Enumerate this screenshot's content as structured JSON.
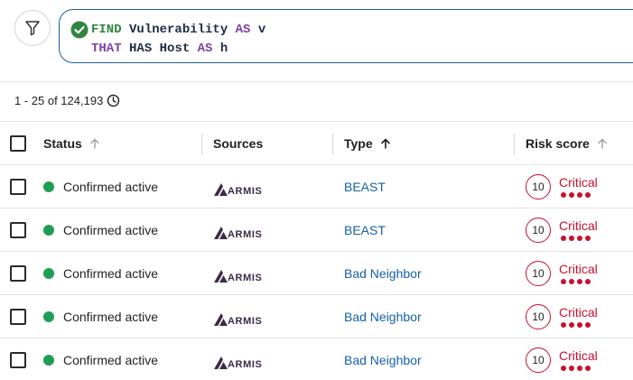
{
  "query": {
    "line1": {
      "kw1": "FIND",
      "ident1": "Vulnerability",
      "kw2": "AS",
      "ident2": "v"
    },
    "line2": {
      "kw1": "THAT",
      "kw2": "HAS",
      "ident1": "Host",
      "kw3": "AS",
      "ident2": "h"
    },
    "valid_icon": "check-circle-icon"
  },
  "filter_button_icon": "funnel-icon",
  "results": {
    "range_label": "1 - 25 of 124,193",
    "icon": "clock-icon"
  },
  "table": {
    "headers": {
      "status": "Status",
      "sources": "Sources",
      "type": "Type",
      "risk": "Risk score"
    },
    "sort": {
      "status": "inactive-up",
      "type": "active-up",
      "risk": "inactive-up"
    },
    "rows": [
      {
        "status": "Confirmed active",
        "source": "ARMIS",
        "type": "BEAST",
        "score": "10",
        "severity": "Critical",
        "severity_level": 4
      },
      {
        "status": "Confirmed active",
        "source": "ARMIS",
        "type": "BEAST",
        "score": "10",
        "severity": "Critical",
        "severity_level": 4
      },
      {
        "status": "Confirmed active",
        "source": "ARMIS",
        "type": "Bad Neighbor",
        "score": "10",
        "severity": "Critical",
        "severity_level": 4
      },
      {
        "status": "Confirmed active",
        "source": "ARMIS",
        "type": "Bad Neighbor",
        "score": "10",
        "severity": "Critical",
        "severity_level": 4
      },
      {
        "status": "Confirmed active",
        "source": "ARMIS",
        "type": "Bad Neighbor",
        "score": "10",
        "severity": "Critical",
        "severity_level": 4
      }
    ]
  },
  "colors": {
    "status_active": "#1f9d55",
    "critical": "#c8102e",
    "link": "#1560a8",
    "keyword_green": "#2e8540",
    "keyword_purple": "#7a3fa8"
  }
}
